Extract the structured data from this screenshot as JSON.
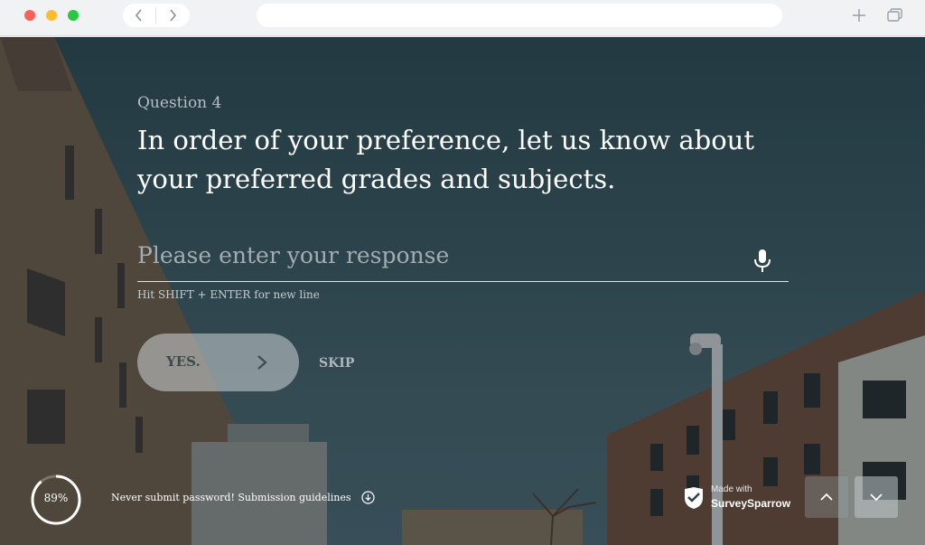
{
  "question": {
    "number_label": "Question 4",
    "title": "In order of your preference, let us know about your preferred grades and subjects."
  },
  "answer": {
    "placeholder": "Please enter your response",
    "hint": "Hit SHIFT + ENTER for new line",
    "mic_icon": "microphone-icon"
  },
  "actions": {
    "yes_label": "YES.",
    "yes_icon": "chevron-right-icon",
    "skip_label": "SKIP"
  },
  "footer": {
    "progress_percent": 89,
    "progress_label": "89%",
    "guidelines_text": "Never submit password! Submission guidelines",
    "guidelines_icon": "download-circle-icon",
    "brand_made": "Made with",
    "brand_name": "SurveySparrow",
    "nav_up_icon": "chevron-up-icon",
    "nav_down_icon": "chevron-down-icon"
  },
  "browser": {
    "back_icon": "chevron-left-icon",
    "forward_icon": "chevron-right-icon",
    "new_tab_icon": "plus-icon",
    "tabs_icon": "tabs-icon"
  },
  "colors": {
    "sky": "#2c4750",
    "accent_text": "#ffffff",
    "muted_text": "#b5bfc3"
  }
}
